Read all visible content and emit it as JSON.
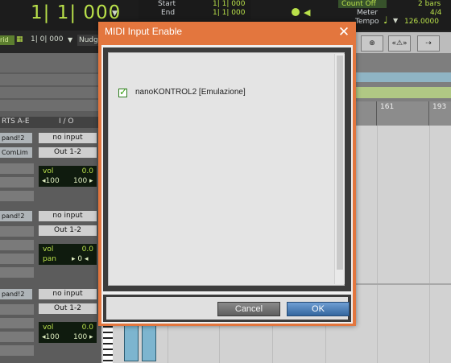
{
  "transport": {
    "counter": "1| 1| 000",
    "start_label": "Start",
    "start_value": "1| 1| 000",
    "end_label": "End",
    "end_value": "1| 1| 000",
    "count_off": "Count Off",
    "count_off_bars": "2 bars",
    "meter_label": "Meter",
    "meter_value": "4/4",
    "tempo_label": "Tempo",
    "tempo_value": "126.0000"
  },
  "edit_bar": {
    "grid_chip": "rid",
    "grid_value": "1| 0| 000",
    "nudge_label": "Nudg"
  },
  "left_panel": {
    "header_inserts": "RTS A-E",
    "header_io": "I / O",
    "tracks": [
      {
        "insert": "pand!2",
        "insert2": "ComLim",
        "input": "no input",
        "output": "Out 1-2",
        "vol_label": "vol",
        "vol_value": "0.0",
        "pan_left": "◂100",
        "pan_right": "100 ▸"
      },
      {
        "insert": "pand!2",
        "input": "no input",
        "output": "Out 1-2",
        "vol_label": "vol",
        "vol_value": "0.0",
        "pan_label": "pan",
        "pan_value": "▸ 0 ◂"
      },
      {
        "insert": "pand!2",
        "input": "no input",
        "output": "Out 1-2",
        "vol_label": "vol",
        "vol_value": "0.0",
        "pan_left": "◂100",
        "pan_right": "100 ▸"
      }
    ]
  },
  "ruler": {
    "bar_161": "161",
    "bar_193": "193"
  },
  "dialog": {
    "title": "MIDI Input Enable",
    "items": [
      {
        "label": "nanoKONTROL2 [Emulazione]",
        "checked": true
      }
    ],
    "cancel_label": "Cancel",
    "ok_label": "OK",
    "accent_color": "#e3763e"
  }
}
